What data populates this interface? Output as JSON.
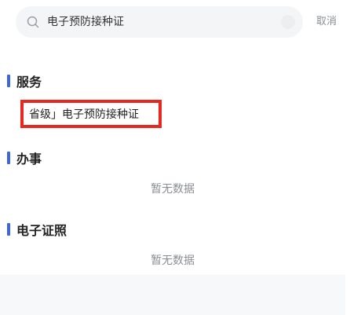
{
  "search": {
    "query": "电子预防接种证",
    "cancel_label": "取消"
  },
  "sections": {
    "services": {
      "title": "服务",
      "items": [
        "省级」电子预防接种证"
      ]
    },
    "affairs": {
      "title": "办事",
      "empty": "暂无数据"
    },
    "licenses": {
      "title": "电子证照",
      "empty": "暂无数据"
    }
  },
  "colors": {
    "accent": "#3a65e8",
    "highlight": "#e8281e",
    "muted_text": "#8a8e94"
  },
  "icons": {
    "search": "search-icon"
  }
}
